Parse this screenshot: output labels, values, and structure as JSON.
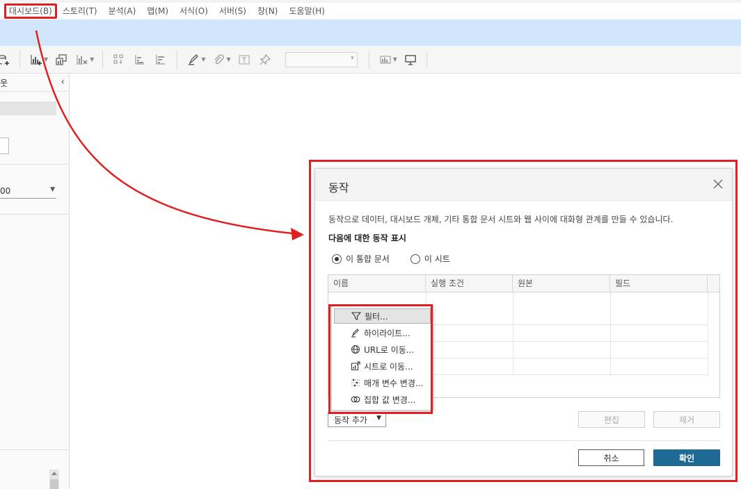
{
  "menu": {
    "items": [
      "대시보드(B)",
      "스토리(T)",
      "분석(A)",
      "맵(M)",
      "서식(O)",
      "서버(S)",
      "창(N)",
      "도움말(H)"
    ]
  },
  "left_panel": {
    "header_text": "웃",
    "dropdown_value": "00"
  },
  "dialog": {
    "title": "동작",
    "description": "동작으로 데이터, 대시보드 개체, 기타 통합 문서 시트와 웹 사이에 대화형 관계를 만들 수 있습니다.",
    "subheading": "다음에 대한 동작 표시",
    "radios": [
      {
        "label": "이 통합 문서",
        "selected": true
      },
      {
        "label": "이 시트",
        "selected": false
      }
    ],
    "table_headers": [
      "이름",
      "실행 조건",
      "원본",
      "필드"
    ],
    "add_action_label": "동작 추가",
    "edit_label": "편집",
    "remove_label": "제거",
    "cancel_label": "취소",
    "ok_label": "확인"
  },
  "context_menu": {
    "items": [
      {
        "label": "필터...",
        "icon": "filter-icon"
      },
      {
        "label": "하이라이트...",
        "icon": "highlight-icon"
      },
      {
        "label": "URL로 이동...",
        "icon": "globe-icon"
      },
      {
        "label": "시트로 이동...",
        "icon": "go-to-sheet-icon"
      },
      {
        "label": "매개 변수 변경...",
        "icon": "parameter-icon"
      },
      {
        "label": "집합 값 변경...",
        "icon": "set-icon"
      }
    ]
  },
  "colors": {
    "annotation_red": "#e02020",
    "ok_button": "#1f6a94",
    "blue_band": "#cfe6fb"
  }
}
